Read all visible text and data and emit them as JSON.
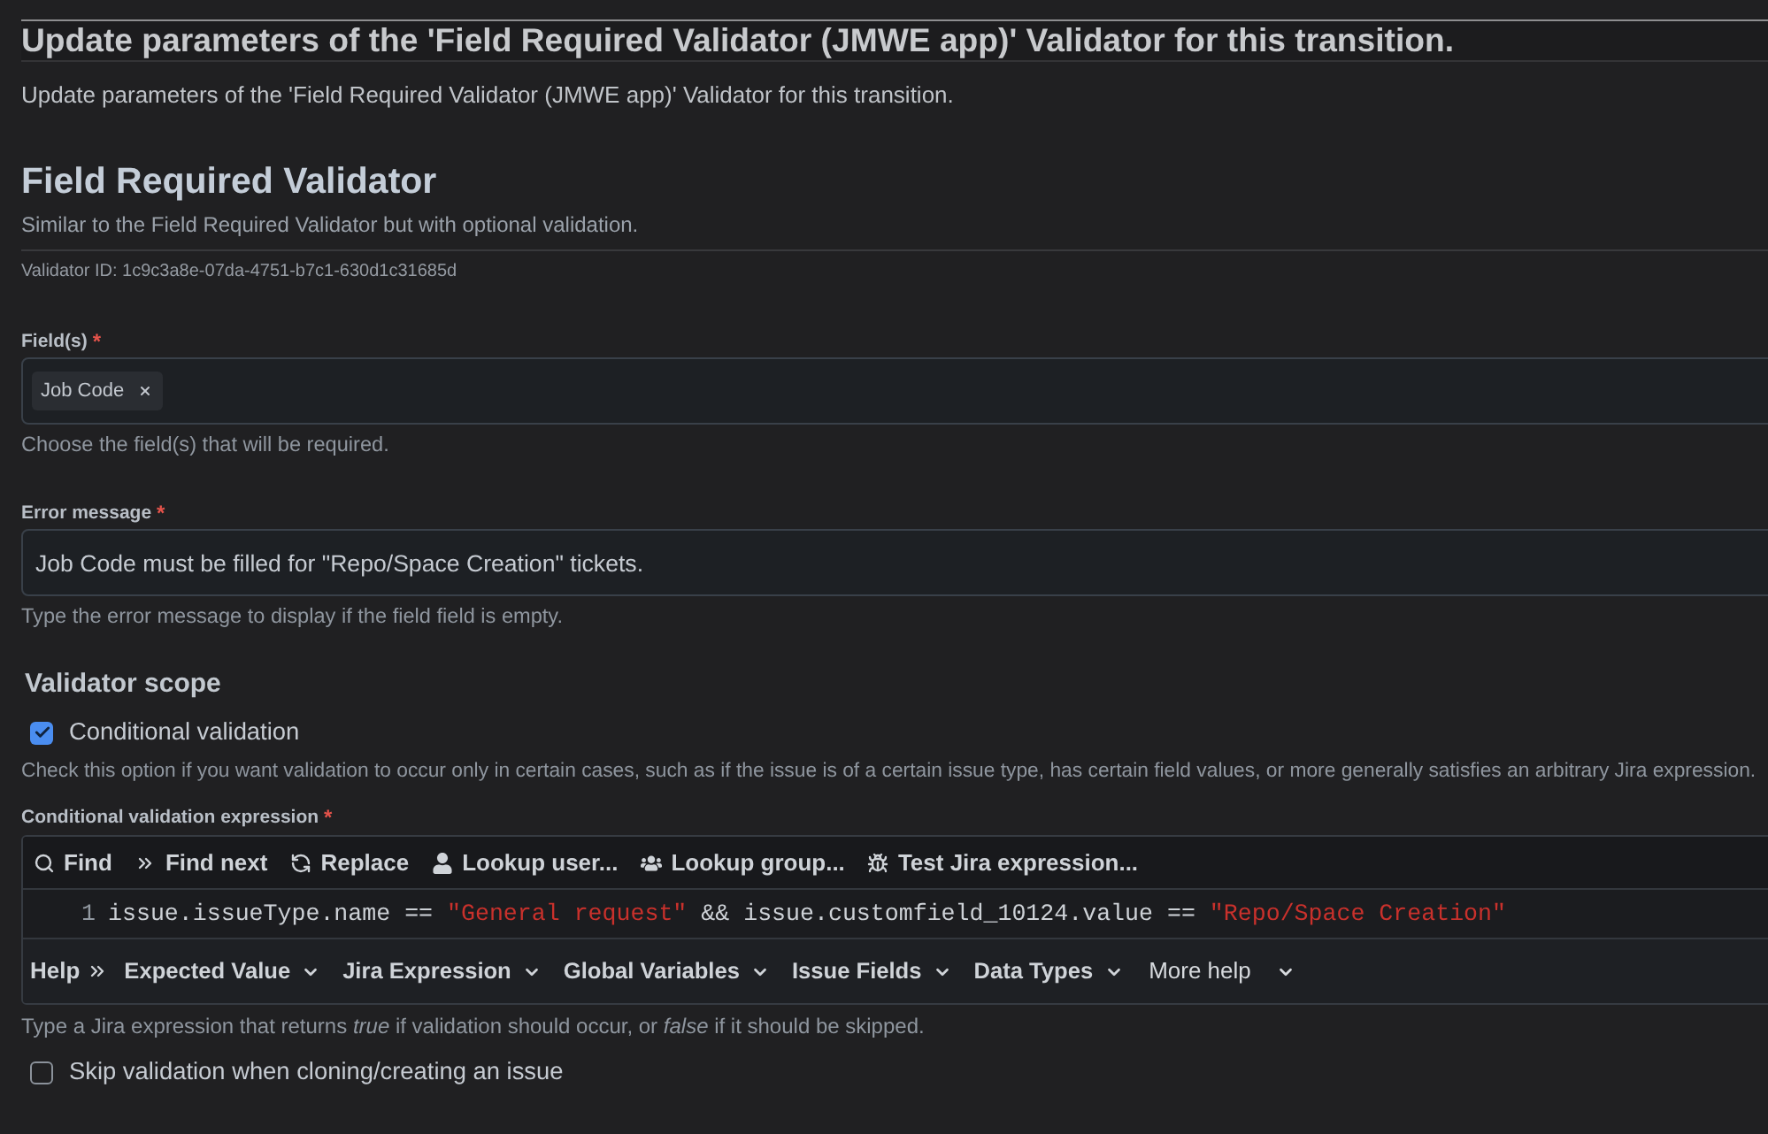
{
  "header": {
    "title": "Update parameters of the 'Field Required Validator (JMWE app)' Validator for this transition.",
    "subtitle": "Update parameters of the 'Field Required Validator (JMWE app)' Validator for this transition."
  },
  "validator": {
    "title": "Field Required Validator",
    "description": "Similar to the Field Required Validator but with optional validation.",
    "id_text": "Validator ID: 1c9c3a8e-07da-4751-b7c1-630d1c31685d"
  },
  "fields": [
    {
      "kind": "multiselect",
      "label": "Field(s)",
      "required_mark": "*",
      "chips": [
        {
          "label": "Job Code"
        }
      ],
      "help": "Choose the field(s) that will be required."
    },
    {
      "kind": "text",
      "label": "Error message",
      "required_mark": "*",
      "value": "Job Code must be filled for \"Repo/Space Creation\" tickets.",
      "help": "Type the error message to display if the field field is empty."
    }
  ],
  "scope": {
    "title": "Validator scope",
    "conditional": {
      "label": "Conditional validation",
      "checked": true
    },
    "help": "Check this option if you want validation to occur only in certain cases, such as if the issue is of a certain issue type, has certain field values, or more generally satisfies an arbitrary Jira expression."
  },
  "expression": {
    "label": "Conditional validation expression",
    "required_mark": "*",
    "toolbar": [
      {
        "label": "Find"
      },
      {
        "label": "Find next"
      },
      {
        "label": "Replace"
      },
      {
        "label": "Lookup user..."
      },
      {
        "label": "Lookup group..."
      },
      {
        "label": "Test Jira expression..."
      }
    ],
    "lines": [
      {
        "number": "1",
        "tokens": [
          {
            "kind": "code",
            "text": "issue.issueType.name == "
          },
          {
            "kind": "string",
            "text": "\"General request\""
          },
          {
            "kind": "code",
            "text": " && issue.customfield_10124.value == "
          },
          {
            "kind": "string",
            "text": "\"Repo/Space Creation\""
          }
        ]
      }
    ],
    "help_bar": {
      "label": "Help",
      "menus": [
        {
          "kind": "dropdown",
          "label": "Expected Value"
        },
        {
          "kind": "dropdown",
          "label": "Jira Expression"
        },
        {
          "kind": "dropdown",
          "label": "Global Variables"
        },
        {
          "kind": "dropdown",
          "label": "Issue Fields"
        },
        {
          "kind": "dropdown",
          "label": "Data Types"
        },
        {
          "kind": "more",
          "label": "More help"
        }
      ]
    },
    "help": "Type a Jira expression that returns *true* if validation should occur, or *false* if it should be skipped."
  },
  "skip_on_clone": {
    "label": "Skip validation when cloning/creating an issue",
    "checked": false
  }
}
